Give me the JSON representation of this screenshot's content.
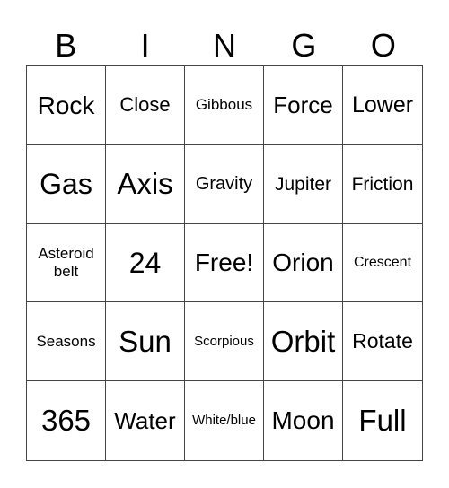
{
  "header": [
    "B",
    "I",
    "N",
    "G",
    "O"
  ],
  "cells": [
    [
      "Rock",
      "Close",
      "Gibbous",
      "Force",
      "Lower"
    ],
    [
      "Gas",
      "Axis",
      "Gravity",
      "Jupiter",
      "Friction"
    ],
    [
      "Asteroid belt",
      "24",
      "Free!",
      "Orion",
      "Crescent"
    ],
    [
      "Seasons",
      "Sun",
      "Scorpious",
      "Orbit",
      "Rotate"
    ],
    [
      "365",
      "Water",
      "White/blue",
      "Moon",
      "Full"
    ]
  ]
}
